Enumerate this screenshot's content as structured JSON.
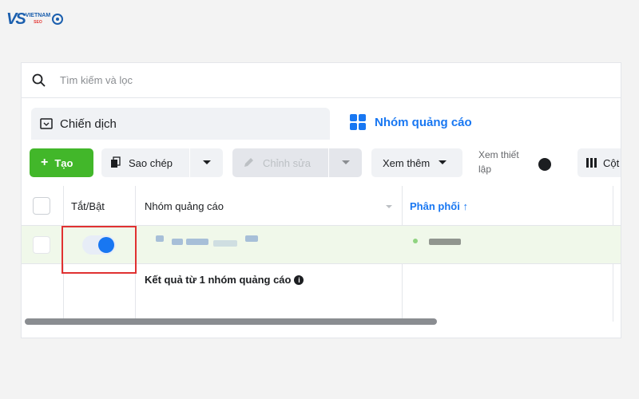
{
  "logo": {
    "mark": "VS",
    "name": "VIETNAM",
    "sub": "SEO"
  },
  "search": {
    "placeholder": "Tìm kiếm và lọc"
  },
  "tabs": [
    {
      "label": "Chiến dịch",
      "active": false
    },
    {
      "label": "Nhóm quảng cáo",
      "active": true
    }
  ],
  "toolbar": {
    "create_label": "Tạo",
    "copy_label": "Sao chép",
    "edit_label": "Chỉnh sửa",
    "more_label": "Xem thêm",
    "setting_label": "Xem thiết lập",
    "columns_label": "Cột"
  },
  "table": {
    "headers": [
      "Tắt/Bật",
      "Nhóm quảng cáo",
      "Phân phối ↑"
    ],
    "row": {
      "toggle_on": true
    },
    "result_text": "Kết quả từ 1 nhóm quảng cáo"
  },
  "colors": {
    "accent": "#1877f2",
    "create": "#42b72a",
    "highlight": "#e03131"
  }
}
